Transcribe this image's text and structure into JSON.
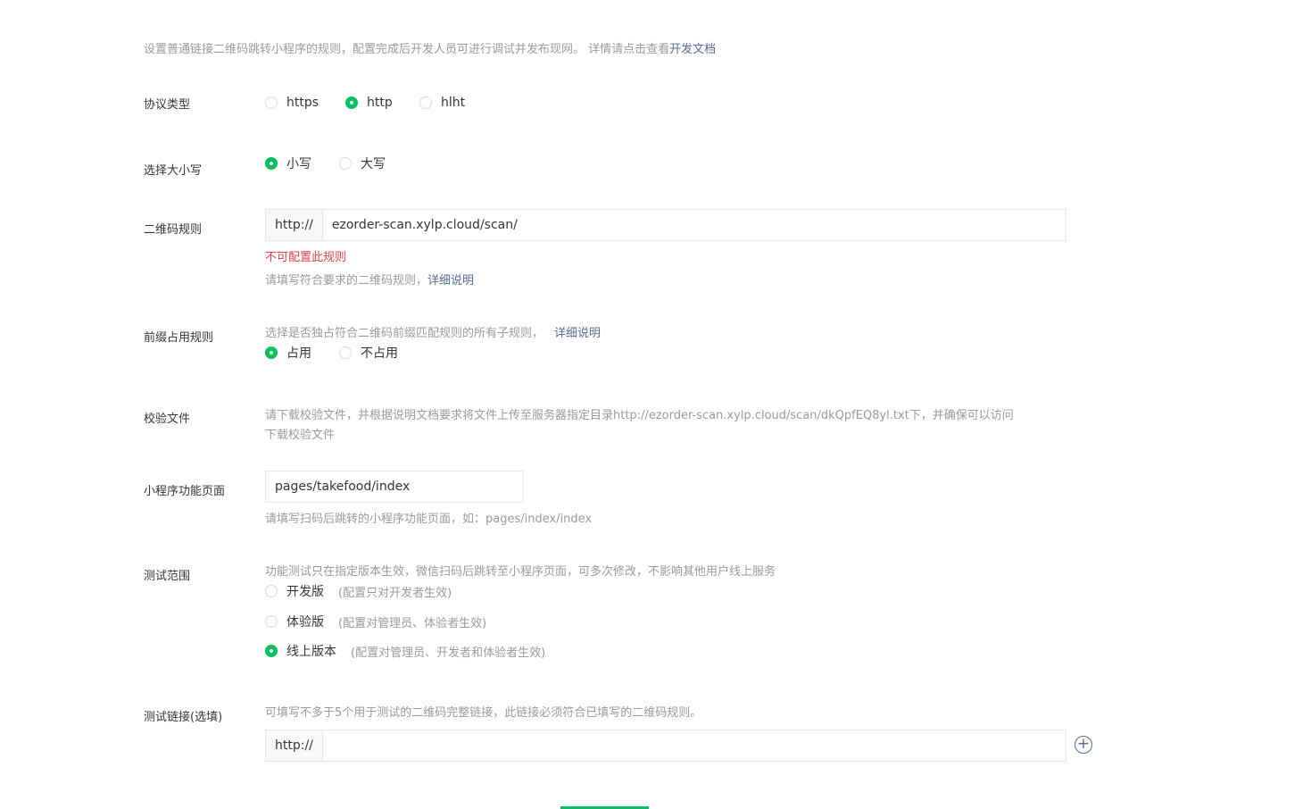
{
  "intro": {
    "text": "设置普通链接二维码跳转小程序的规则，配置完成后开发人员可进行调试并发布现网。 详情请点击查看",
    "link": "开发文档"
  },
  "protocol": {
    "label": "协议类型",
    "options": [
      "https",
      "http",
      "hlht"
    ],
    "selected": "http"
  },
  "case": {
    "label": "选择大小写",
    "options": [
      "小写",
      "大写"
    ],
    "selected": "小写"
  },
  "qr_rule": {
    "label": "二维码规则",
    "prefix": "http://",
    "value": "ezorder-scan.xylp.cloud/scan/",
    "error": "不可配置此规则",
    "tip": "请填写符合要求的二维码规则，",
    "tip_link": "详细说明"
  },
  "prefix_rule": {
    "label": "前缀占用规则",
    "tip": "选择是否独占符合二维码前缀匹配规则的所有子规则，",
    "tip_link": "详细说明",
    "options": [
      "占用",
      "不占用"
    ],
    "selected": "占用"
  },
  "verify_file": {
    "label": "校验文件",
    "tip": "请下载校验文件，并根据说明文档要求将文件上传至服务器指定目录http://ezorder-scan.xylp.cloud/scan/dkQpfEQ8yl.txt下，并确保可以访问",
    "download_link": "下载校验文件"
  },
  "mp_page": {
    "label": "小程序功能页面",
    "value": "pages/takefood/index",
    "tip": "请填写扫码后跳转的小程序功能页面，如：pages/index/index"
  },
  "test_scope": {
    "label": "测试范围",
    "tip": "功能测试只在指定版本生效，微信扫码后跳转至小程序页面，可多次修改，不影响其他用户线上服务",
    "options": [
      {
        "name": "开发版",
        "note": "(配置只对开发者生效)"
      },
      {
        "name": "体验版",
        "note": "(配置对管理员、体验者生效)"
      },
      {
        "name": "线上版本",
        "note": "(配置对管理员、开发者和体验者生效)"
      }
    ],
    "selected": "线上版本"
  },
  "test_link": {
    "label": "测试链接(选填)",
    "tip": "可填写不多于5个用于测试的二维码完整链接，此链接必须符合已填写的二维码规则。",
    "prefix": "http://",
    "value": "",
    "add_icon": "plus-circle-icon"
  },
  "colors": {
    "accent": "#07c160",
    "link": "#576b95",
    "error": "#e64340",
    "tip": "#9a9a9a"
  }
}
